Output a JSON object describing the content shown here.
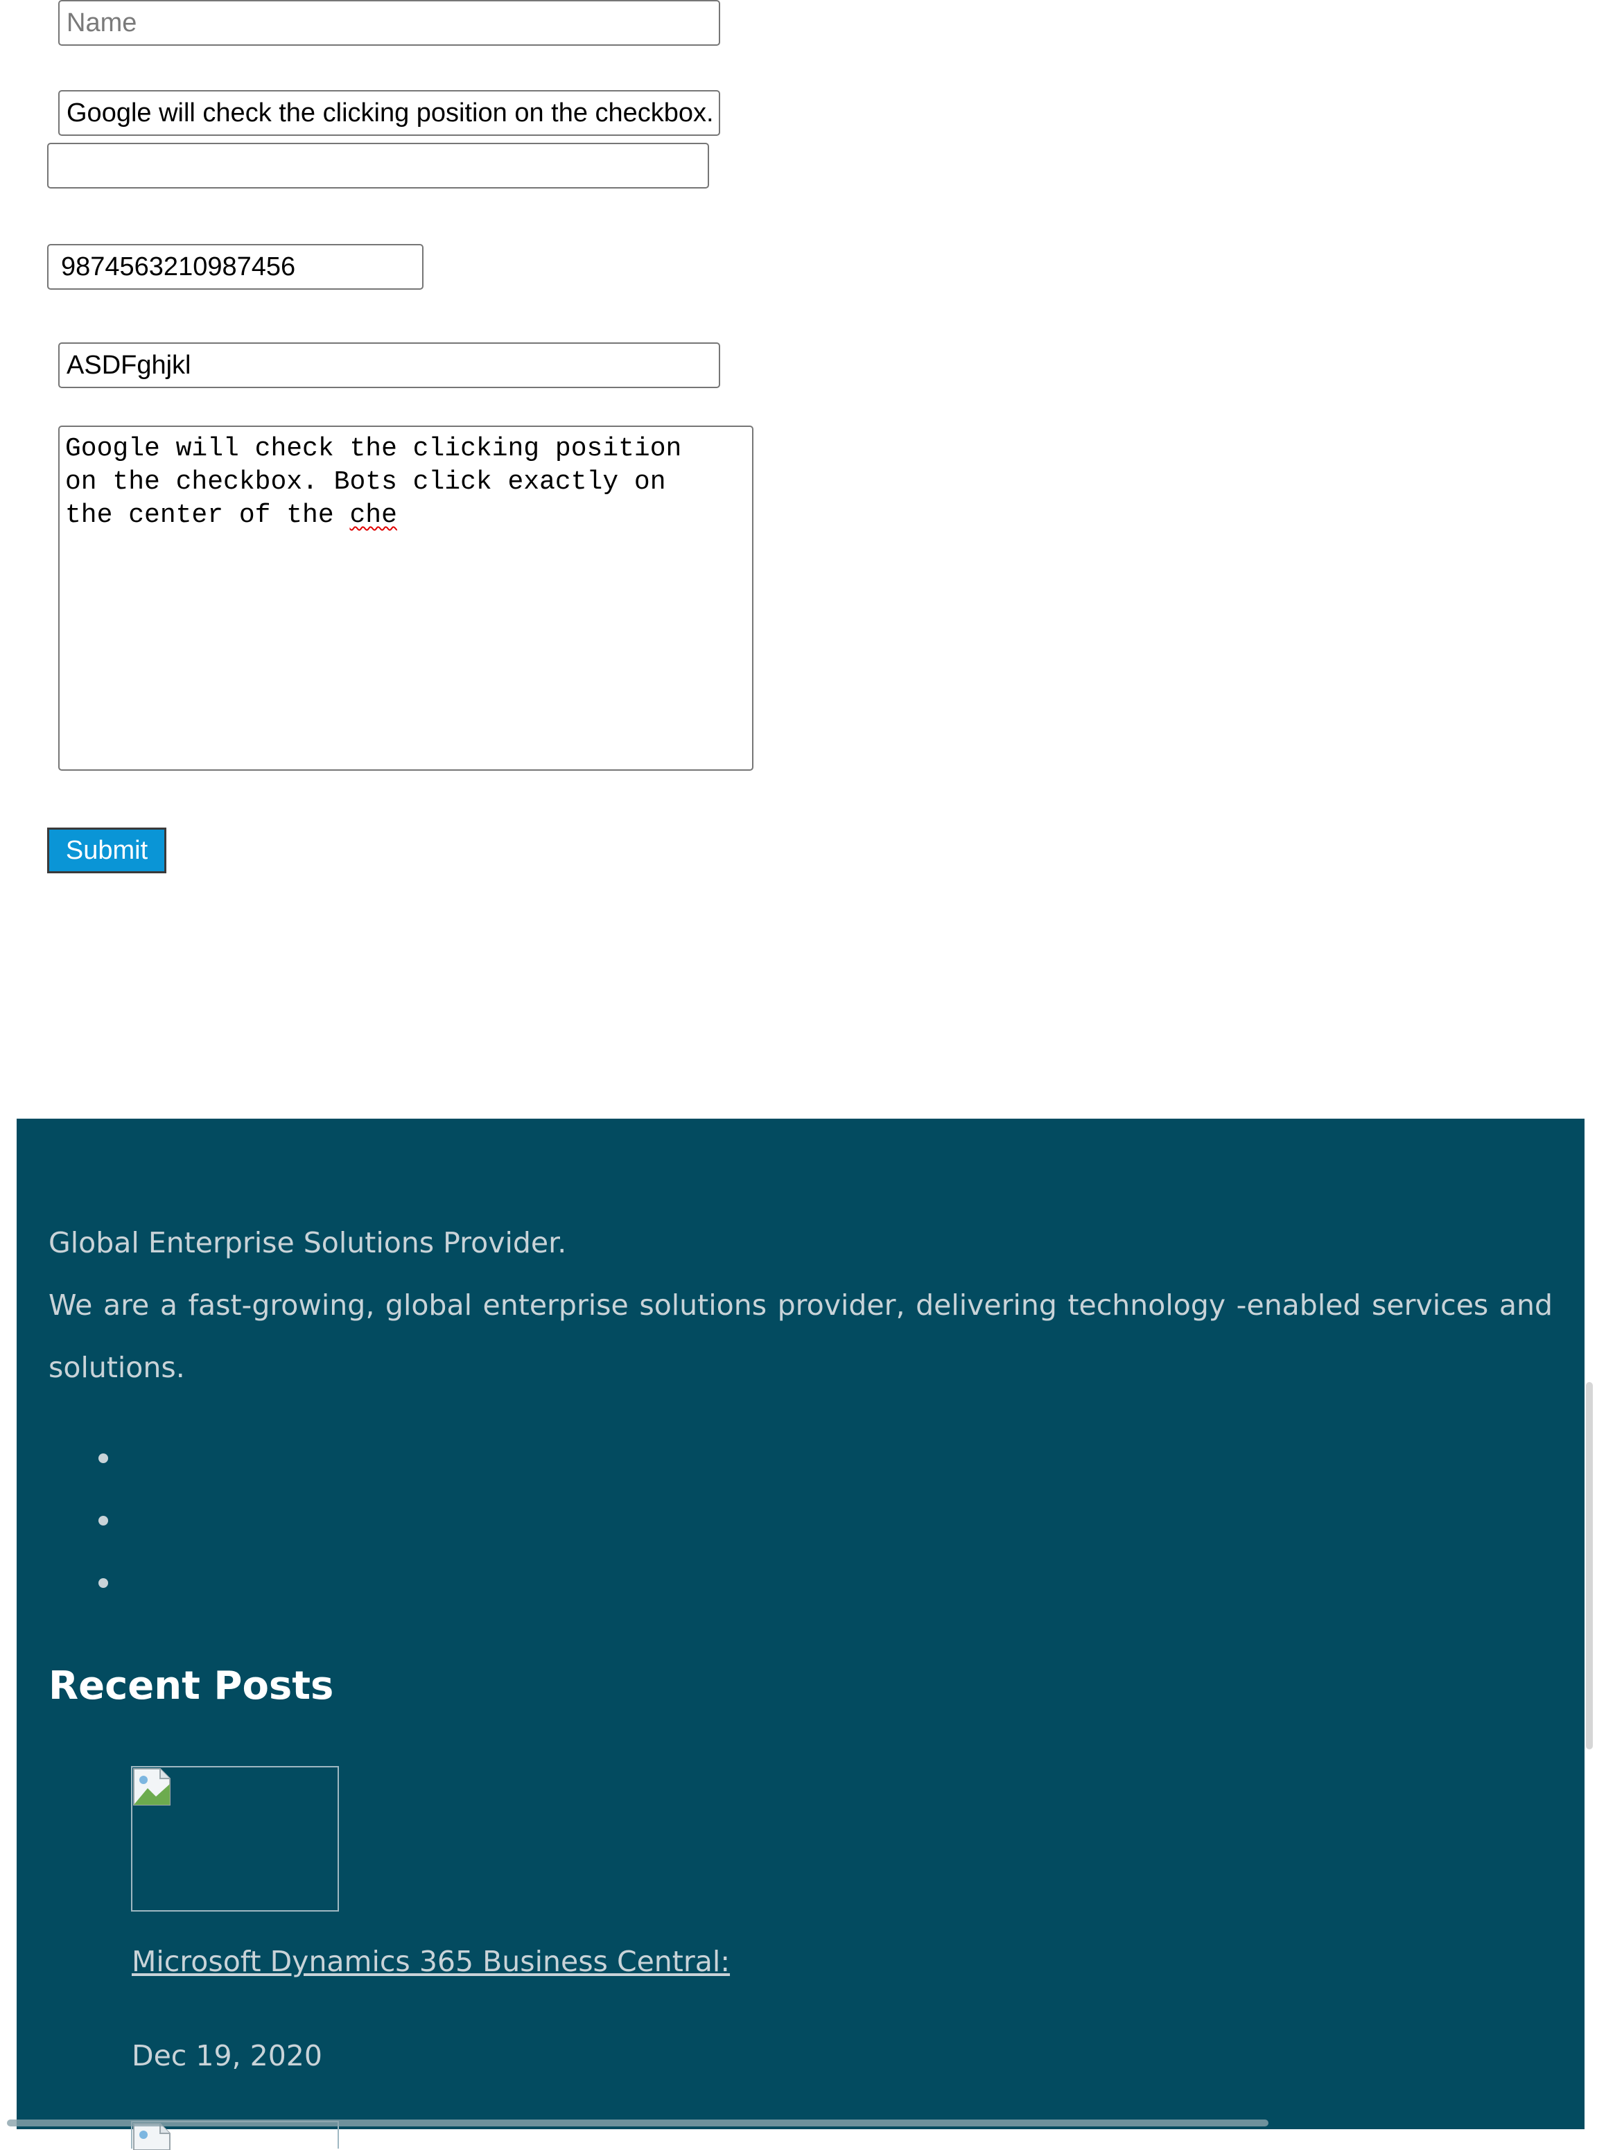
{
  "form": {
    "name_placeholder": "Name",
    "subject_value": "Google will check the clicking position on the checkbox. Bots click exactly on the center of the che",
    "blank_value": "",
    "phone_value": "9874563210987456",
    "captcha_value": "ASDFghjkl",
    "message_line_1": "Google will check the clicking position",
    "message_line_2": "on the checkbox. Bots click exactly on",
    "message_line_3_prefix": "the center of the ",
    "message_line_3_misspelled": "che",
    "submit_label": "Submit",
    "submit_color": "#0a95d6"
  },
  "footer": {
    "background_color": "#034b60",
    "tagline": "Global Enterprise Solutions Provider.",
    "description": "We are a fast-growing, global enterprise solutions provider, delivering technology -enabled services and solutions.",
    "social_items": [
      "",
      "",
      ""
    ],
    "recent_posts_title": "Recent Posts",
    "recent_posts": [
      {
        "title": "Microsoft Dynamics 365 Business Central:",
        "date": "Dec 19, 2020",
        "thumbnail_icon": "broken-image-icon"
      },
      {
        "thumbnail_icon": "broken-image-icon"
      }
    ]
  }
}
